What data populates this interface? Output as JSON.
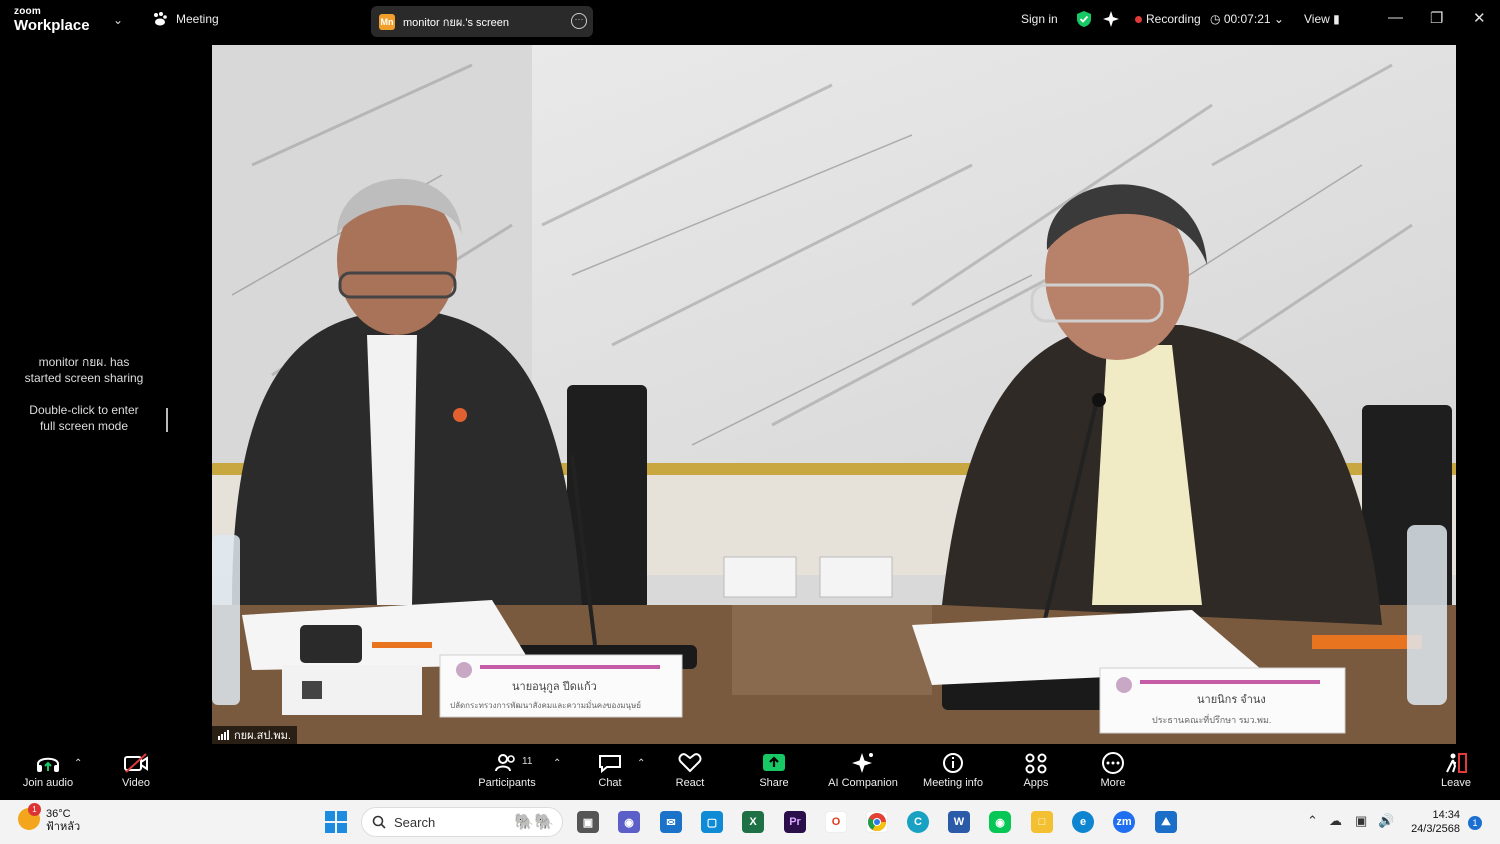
{
  "app": {
    "logo_line1": "zoom",
    "logo_line2": "Workplace",
    "meeting_label": "Meeting",
    "share_badge": "Mn",
    "share_title": "monitor กยผ.'s screen",
    "sign_in": "Sign in",
    "recording_label": "Recording",
    "timer": "00:07:21",
    "view_label": "View"
  },
  "left_panel": {
    "line1": "monitor กยผ. has",
    "line2": "started screen sharing",
    "line3": "Double-click to enter",
    "line4": "full screen mode"
  },
  "video": {
    "label": "กยผ.สป.พม.",
    "nameplate_left_name": "นายอนุกูล ปีดแก้ว",
    "nameplate_left_title": "ปลัดกระทรวงการพัฒนาสังคมและความมั่นคงของมนุษย์",
    "nameplate_right_name": "นายนิกร จำนง",
    "nameplate_right_title": "ประธานคณะที่ปรึกษา รมว.พม."
  },
  "toolbar": {
    "join_audio": "Join audio",
    "video": "Video",
    "participants": "Participants",
    "participants_count": "11",
    "chat": "Chat",
    "react": "React",
    "share": "Share",
    "ai_companion": "AI Companion",
    "meeting_info": "Meeting info",
    "apps": "Apps",
    "more": "More",
    "leave": "Leave"
  },
  "taskbar": {
    "weather_temp": "36°C",
    "weather_desc": "ฟ้าหลัว",
    "weather_badge": "1",
    "search_placeholder": "Search",
    "time": "14:34",
    "date": "24/3/2568",
    "notification_count": "1"
  },
  "colors": {
    "accent_green": "#17c964",
    "record_red": "#e03b3b",
    "share_orange": "#f0a02a"
  }
}
